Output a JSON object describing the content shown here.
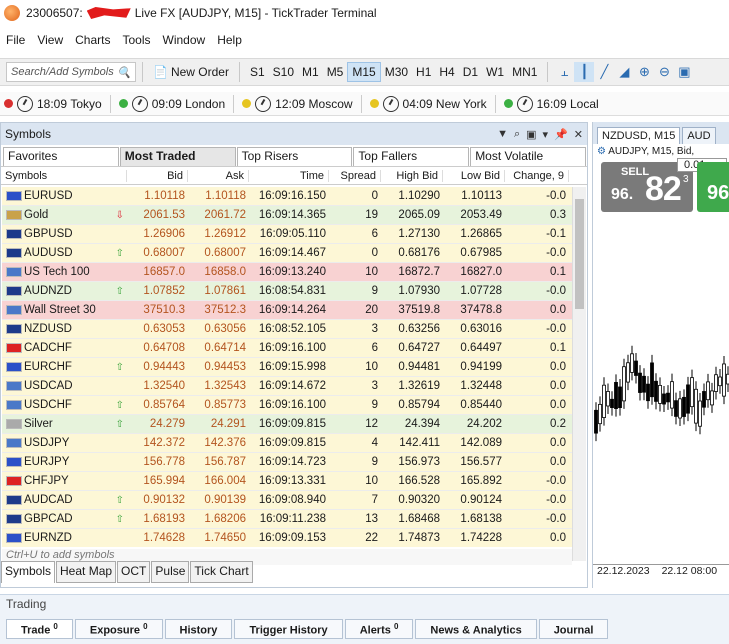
{
  "window": {
    "account": "23006507:",
    "title": "Live FX [AUDJPY, M15] - TickTrader Terminal"
  },
  "menu": [
    "File",
    "View",
    "Charts",
    "Tools",
    "Window",
    "Help"
  ],
  "toolbar": {
    "search_placeholder": "Search/Add Symbols",
    "new_order": "New Order",
    "timeframes": [
      "S1",
      "S10",
      "M1",
      "M5",
      "M15",
      "M30",
      "H1",
      "H4",
      "D1",
      "W1",
      "MN1"
    ],
    "active_timeframe": "M15"
  },
  "clocks": [
    {
      "time": "18:09",
      "city": "Tokyo",
      "color": "#d93030"
    },
    {
      "time": "09:09",
      "city": "London",
      "color": "#3cb043"
    },
    {
      "time": "12:09",
      "city": "Moscow",
      "color": "#e6c520"
    },
    {
      "time": "04:09",
      "city": "New York",
      "color": "#e6c520"
    },
    {
      "time": "16:09",
      "city": "Local",
      "color": "#3cb043"
    }
  ],
  "symbols_panel": {
    "title": "Symbols",
    "tabs": [
      "Favorites",
      "Most Traded",
      "Top Risers",
      "Top Fallers",
      "Most Volatile"
    ],
    "active_tab": "Most Traded",
    "columns": [
      "Symbols",
      "Bid",
      "Ask",
      "Time",
      "Spread",
      "High Bid",
      "Low Bid",
      "Change, 9"
    ],
    "rows": [
      {
        "symbol": "EURUSD",
        "bid": "1.10118",
        "ask": "1.10118",
        "time": "16:09:16.150",
        "spread": "0",
        "high": "1.10290",
        "low": "1.10113",
        "change": "-0.0",
        "arrow": "",
        "bg": "#fdf7d6",
        "flag": "#2b50c8"
      },
      {
        "symbol": "Gold",
        "bid": "2061.53",
        "ask": "2061.72",
        "time": "16:09:14.365",
        "spread": "19",
        "high": "2065.09",
        "low": "2053.49",
        "change": "0.3",
        "arrow": "down",
        "bg": "#e7f3dc",
        "flag": "#c9a24a"
      },
      {
        "symbol": "GBPUSD",
        "bid": "1.26906",
        "ask": "1.26912",
        "time": "16:09:05.110",
        "spread": "6",
        "high": "1.27130",
        "low": "1.26865",
        "change": "-0.1",
        "arrow": "",
        "bg": "#fdf7d6",
        "flag": "#1d3a8a"
      },
      {
        "symbol": "AUDUSD",
        "bid": "0.68007",
        "ask": "0.68007",
        "time": "16:09:14.467",
        "spread": "0",
        "high": "0.68176",
        "low": "0.67985",
        "change": "-0.0",
        "arrow": "up",
        "bg": "#fdf7d6",
        "flag": "#1d3a8a"
      },
      {
        "symbol": "US Tech 100",
        "bid": "16857.0",
        "ask": "16858.0",
        "time": "16:09:13.240",
        "spread": "10",
        "high": "16872.7",
        "low": "16827.0",
        "change": "0.1",
        "arrow": "",
        "bg": "#f8d2d2",
        "flag": "#4a78c8"
      },
      {
        "symbol": "AUDNZD",
        "bid": "1.07852",
        "ask": "1.07861",
        "time": "16:08:54.831",
        "spread": "9",
        "high": "1.07930",
        "low": "1.07728",
        "change": "-0.0",
        "arrow": "up",
        "bg": "#e7f3dc",
        "flag": "#1d3a8a"
      },
      {
        "symbol": "Wall Street 30",
        "bid": "37510.3",
        "ask": "37512.3",
        "time": "16:09:14.264",
        "spread": "20",
        "high": "37519.8",
        "low": "37478.8",
        "change": "0.0",
        "arrow": "",
        "bg": "#f8d2d2",
        "flag": "#4a78c8"
      },
      {
        "symbol": "NZDUSD",
        "bid": "0.63053",
        "ask": "0.63056",
        "time": "16:08:52.105",
        "spread": "3",
        "high": "0.63256",
        "low": "0.63016",
        "change": "-0.0",
        "arrow": "",
        "bg": "#fdf7d6",
        "flag": "#1d3a8a"
      },
      {
        "symbol": "CADCHF",
        "bid": "0.64708",
        "ask": "0.64714",
        "time": "16:09:16.100",
        "spread": "6",
        "high": "0.64727",
        "low": "0.64497",
        "change": "0.1",
        "arrow": "",
        "bg": "#fdf7d6",
        "flag": "#d22"
      },
      {
        "symbol": "EURCHF",
        "bid": "0.94443",
        "ask": "0.94453",
        "time": "16:09:15.998",
        "spread": "10",
        "high": "0.94481",
        "low": "0.94199",
        "change": "0.0",
        "arrow": "up",
        "bg": "#fdf7d6",
        "flag": "#2b50c8"
      },
      {
        "symbol": "USDCAD",
        "bid": "1.32540",
        "ask": "1.32543",
        "time": "16:09:14.672",
        "spread": "3",
        "high": "1.32619",
        "low": "1.32448",
        "change": "0.0",
        "arrow": "",
        "bg": "#fdf7d6",
        "flag": "#4a78c8"
      },
      {
        "symbol": "USDCHF",
        "bid": "0.85764",
        "ask": "0.85773",
        "time": "16:09:16.100",
        "spread": "9",
        "high": "0.85794",
        "low": "0.85440",
        "change": "0.0",
        "arrow": "up",
        "bg": "#fdf7d6",
        "flag": "#4a78c8"
      },
      {
        "symbol": "Silver",
        "bid": "24.279",
        "ask": "24.291",
        "time": "16:09:09.815",
        "spread": "12",
        "high": "24.394",
        "low": "24.202",
        "change": "0.2",
        "arrow": "up",
        "bg": "#e7f3dc",
        "flag": "#aaa"
      },
      {
        "symbol": "USDJPY",
        "bid": "142.372",
        "ask": "142.376",
        "time": "16:09:09.815",
        "spread": "4",
        "high": "142.411",
        "low": "142.089",
        "change": "0.0",
        "arrow": "",
        "bg": "#fdf7d6",
        "flag": "#4a78c8"
      },
      {
        "symbol": "EURJPY",
        "bid": "156.778",
        "ask": "156.787",
        "time": "16:09:14.723",
        "spread": "9",
        "high": "156.973",
        "low": "156.577",
        "change": "0.0",
        "arrow": "",
        "bg": "#fdf7d6",
        "flag": "#2b50c8"
      },
      {
        "symbol": "CHFJPY",
        "bid": "165.994",
        "ask": "166.004",
        "time": "16:09:13.331",
        "spread": "10",
        "high": "166.528",
        "low": "165.892",
        "change": "-0.0",
        "arrow": "",
        "bg": "#fdf7d6",
        "flag": "#d22"
      },
      {
        "symbol": "AUDCAD",
        "bid": "0.90132",
        "ask": "0.90139",
        "time": "16:09:08.940",
        "spread": "7",
        "high": "0.90320",
        "low": "0.90124",
        "change": "-0.0",
        "arrow": "up",
        "bg": "#fdf7d6",
        "flag": "#1d3a8a"
      },
      {
        "symbol": "GBPCAD",
        "bid": "1.68193",
        "ask": "1.68206",
        "time": "16:09:11.238",
        "spread": "13",
        "high": "1.68468",
        "low": "1.68138",
        "change": "-0.0",
        "arrow": "up",
        "bg": "#fdf7d6",
        "flag": "#1d3a8a"
      },
      {
        "symbol": "EURNZD",
        "bid": "1.74628",
        "ask": "1.74650",
        "time": "16:09:09.153",
        "spread": "22",
        "high": "1.74873",
        "low": "1.74228",
        "change": "0.0",
        "arrow": "",
        "bg": "#fdf7d6",
        "flag": "#2b50c8"
      }
    ],
    "hint": "Ctrl+U to add symbols",
    "bottom_tabs": [
      "Symbols",
      "Heat Map",
      "OCT",
      "Pulse",
      "Tick Chart"
    ],
    "active_bottom_tab": "Symbols"
  },
  "chart": {
    "tabs": [
      "NZDUSD, M15",
      "AUD"
    ],
    "active_tab": "NZDUSD, M15",
    "info": "AUDJPY, M15, Bid,",
    "sell_label": "SELL",
    "lot": "0.01",
    "sell_price_small": "96.",
    "sell_price_big": "82",
    "sell_price_sup": "3",
    "buy_price_small": "96",
    "dates": [
      "22.12.2023",
      "22.12 08:00"
    ]
  },
  "trading": {
    "title": "Trading",
    "tabs": [
      {
        "label": "Trade",
        "count": "0"
      },
      {
        "label": "Exposure",
        "count": "0"
      },
      {
        "label": "History",
        "count": ""
      },
      {
        "label": "Trigger History",
        "count": ""
      },
      {
        "label": "Alerts",
        "count": "0"
      },
      {
        "label": "News & Analytics",
        "count": ""
      },
      {
        "label": "Journal",
        "count": ""
      }
    ],
    "active_tab": "Trade"
  }
}
